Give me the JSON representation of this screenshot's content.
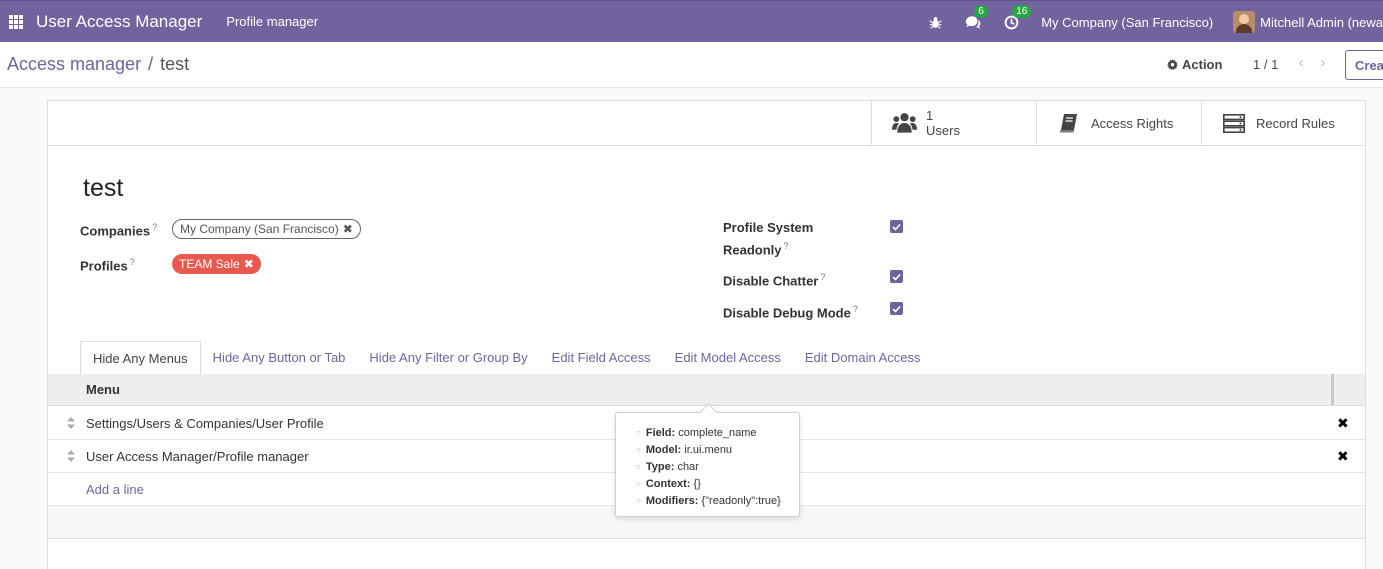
{
  "navbar": {
    "app_title": "User Access Manager",
    "menu_item": "Profile manager",
    "messages_badge": "6",
    "activities_badge": "16",
    "company": "My Company (San Francisco)",
    "user": "Mitchell Admin (newa",
    "color": "#71639e"
  },
  "control_panel": {
    "breadcrumb_parent": "Access manager",
    "breadcrumb_separator": "/",
    "breadcrumb_current": "test",
    "action_label": "Action",
    "pager": "1 / 1",
    "create_label": "Crea"
  },
  "button_box": {
    "users_count": "1",
    "users_label": "Users",
    "access_rights_label": "Access Rights",
    "record_rules_label": "Record Rules"
  },
  "record": {
    "name": "test",
    "companies_label": "Companies",
    "company_tag": "My Company (San Francisco)",
    "profiles_label": "Profiles",
    "profile_tag": "TEAM Sale",
    "help_mark": "?",
    "profile_readonly_label_1": "Profile System",
    "profile_readonly_label_2": "Readonly",
    "profile_readonly_checked": true,
    "disable_chatter_label": "Disable Chatter",
    "disable_chatter_checked": true,
    "disable_debug_label": "Disable Debug Mode",
    "disable_debug_checked": true
  },
  "tabs": [
    {
      "label": "Hide Any Menus",
      "active": true
    },
    {
      "label": "Hide Any Button or Tab",
      "active": false
    },
    {
      "label": "Hide Any Filter or Group By",
      "active": false
    },
    {
      "label": "Edit Field Access",
      "active": false
    },
    {
      "label": "Edit Model Access",
      "active": false
    },
    {
      "label": "Edit Domain Access",
      "active": false
    }
  ],
  "table": {
    "column_header": "Menu",
    "rows": [
      "Settings/Users & Companies/User Profile",
      "User Access Manager/Profile manager"
    ],
    "add_line_label": "Add a line"
  },
  "tooltip": {
    "field_label": "Field:",
    "field_value": "complete_name",
    "model_label": "Model:",
    "model_value": "ir.ui.menu",
    "type_label": "Type:",
    "type_value": "char",
    "context_label": "Context:",
    "context_value": "{}",
    "modifiers_label": "Modifiers:",
    "modifiers_value": "{\"readonly\":true}"
  }
}
